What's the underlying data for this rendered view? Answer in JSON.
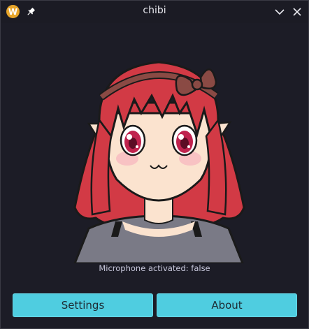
{
  "window": {
    "title": "chibi",
    "app_icon_letter": "W",
    "accent_color": "#4fcde0"
  },
  "titlebar": {
    "icons": [
      "app-logo-icon",
      "pin-icon",
      "chevron-down-icon",
      "close-icon"
    ]
  },
  "status": {
    "microphone_text": "Microphone activated: false"
  },
  "buttons": {
    "settings_label": "Settings",
    "about_label": "About"
  }
}
